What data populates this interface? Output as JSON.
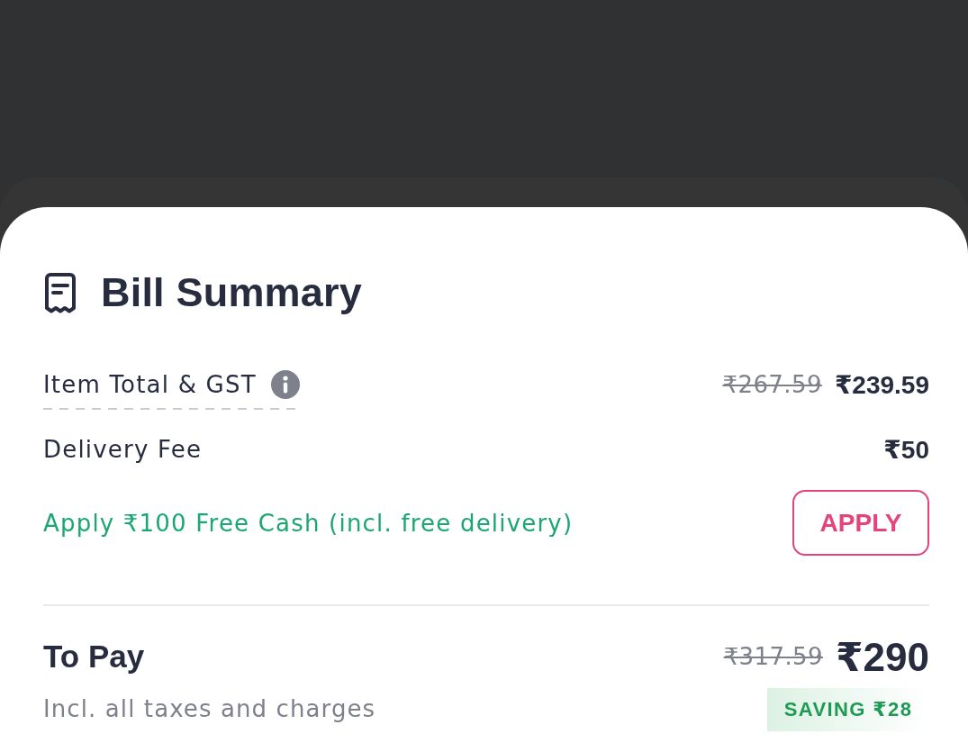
{
  "header": {
    "title": "Bill Summary"
  },
  "lines": [
    {
      "label": "Item Total & GST",
      "info": true,
      "original_amount": "₹267.59",
      "amount": "₹239.59"
    },
    {
      "label": "Delivery Fee",
      "info": false,
      "amount": "₹50"
    }
  ],
  "offer": {
    "text": "Apply ₹100 Free Cash (incl. free delivery)",
    "button": "APPLY"
  },
  "total": {
    "label": "To Pay",
    "subtitle": "Incl. all taxes and charges",
    "original_amount": "₹317.59",
    "amount": "₹290",
    "saving": "SAVING ₹28"
  }
}
